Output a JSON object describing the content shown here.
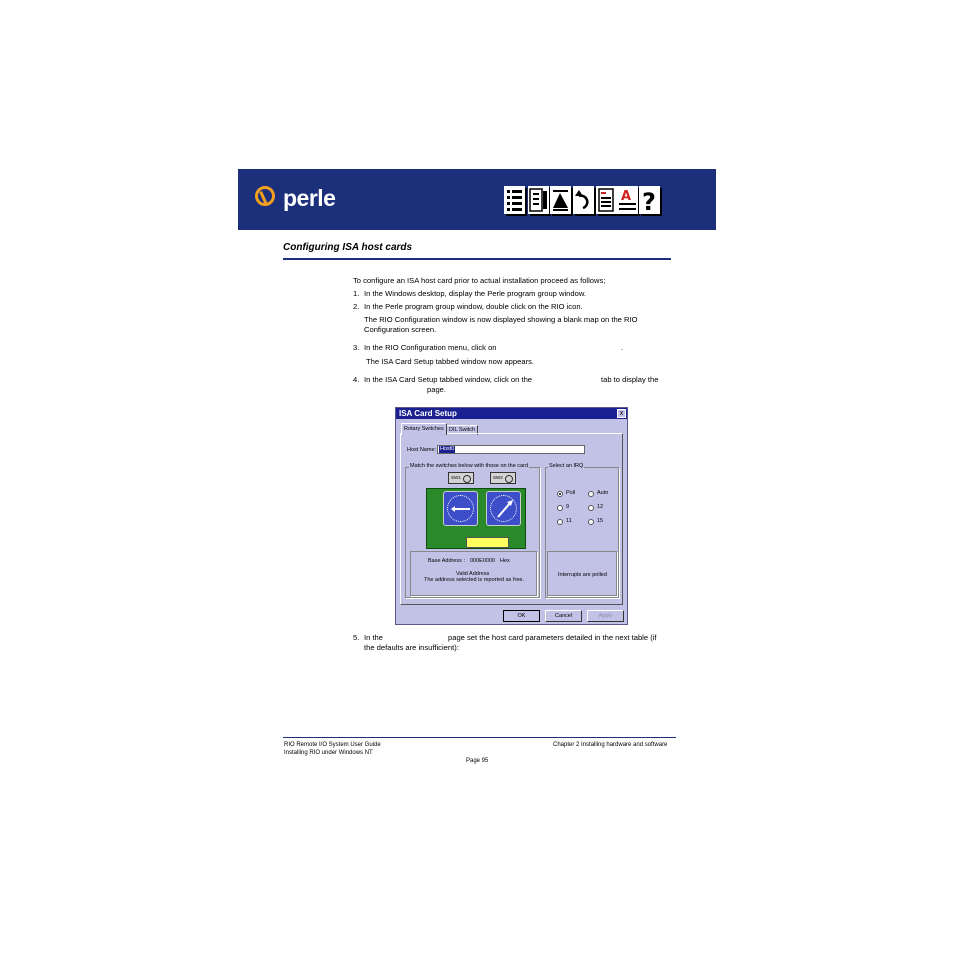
{
  "banner": {
    "logo_text": "perle"
  },
  "section_title": "Configuring ISA host cards",
  "body": {
    "intro": "To configure an ISA host card prior to actual installation proceed as follows;",
    "step1_num": "1.",
    "step1": "In the Windows desktop, display the Perle program group window.",
    "step2_num": "2.",
    "step2": "In the Perle program group window, double click on the RIO icon.",
    "step2_note_1": "The RIO Configuration window is now displayed showing a blank map on the RIO",
    "step2_note_2": "Configuration screen.",
    "step3_num": "3.",
    "step3": "In the RIO Configuration menu, click on",
    "step3_end": ".",
    "step3_note": "The ISA Card Setup tabbed window now appears.",
    "step4_num": "4.",
    "step4": "In the ISA Card Setup tabbed window, click on the",
    "step4_mid": "tab to display the",
    "step4_end": "page.",
    "step5_num": "5.",
    "step5": "In the",
    "step5_mid": "page set the host card parameters detailed in the next table (if",
    "step5_end": "the defaults are insufficient):"
  },
  "dialog": {
    "title": "ISA Card Setup",
    "close": "x",
    "tabs": [
      "Rotary Switches",
      "DIL Switch"
    ],
    "host_name_label": "Host Name:",
    "host_name_value": "Host0",
    "match_group_label": "Match the switches below with those on the card",
    "irq_group_label": "Select an IRQ",
    "sw1": "SW1",
    "sw2": "SW2",
    "irq_options": [
      {
        "label": "Poll",
        "selected": true
      },
      {
        "label": "Auto",
        "selected": false
      },
      {
        "label": "9",
        "selected": false
      },
      {
        "label": "12",
        "selected": false
      },
      {
        "label": "11",
        "selected": false
      },
      {
        "label": "15",
        "selected": false
      }
    ],
    "base_address_label": "Base Address :",
    "base_address_value": "000E0000",
    "base_address_unit": "Hex",
    "valid_address": "Valid Address",
    "address_note": "The address selected is reported as free.",
    "interrupt_note": "Interrupts are polled",
    "buttons": {
      "ok": "OK",
      "cancel": "Cancel",
      "apply": "Apply"
    }
  },
  "footer": {
    "left1": "RIO Remote I/O System User Guide",
    "left2": "Installing RIO under Windows NT",
    "right": "Chapter 2 Installing hardware and software",
    "page": "Page 95"
  }
}
